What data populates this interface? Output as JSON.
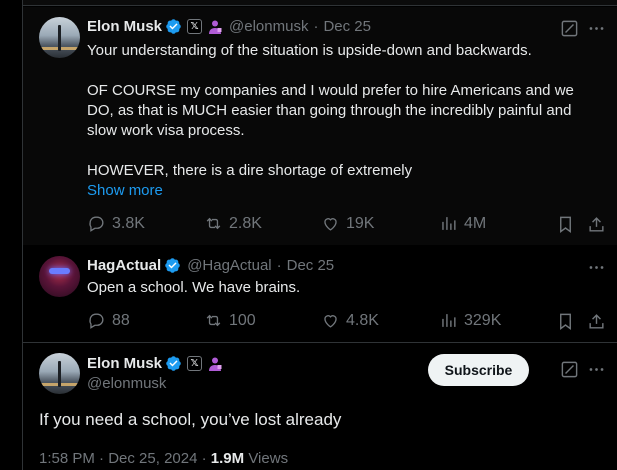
{
  "colors": {
    "background": "#000000",
    "text": "#e7e9ea",
    "muted": "#71767b",
    "link": "#1d9bf0",
    "verified": "#1d9bf0",
    "affiliate_badge": "#b05cd6"
  },
  "post1": {
    "name": "Elon Musk",
    "handle": "@elonmusk",
    "separator": "·",
    "date": "Dec 25",
    "paragraphs": [
      "Your understanding of the situation is upside-down and backwards.",
      "OF COURSE my companies and I would prefer to hire Americans and we DO, as that is MUCH easier than going through the incredibly painful and slow work visa process.",
      "HOWEVER, there is a dire shortage of extremely"
    ],
    "show_more": "Show more",
    "replies": "3.8K",
    "reposts": "2.8K",
    "likes": "19K",
    "views": "4M",
    "icons": [
      "verified-icon",
      "x-badge-icon",
      "affiliate-badge-icon",
      "grok-icon",
      "more-icon",
      "reply-icon",
      "repost-icon",
      "like-icon",
      "views-icon",
      "bookmark-icon",
      "share-icon"
    ]
  },
  "post2": {
    "name": "HagActual",
    "handle": "@HagActual",
    "separator": "·",
    "date": "Dec 25",
    "text": "Open a school. We have brains.",
    "replies": "88",
    "reposts": "100",
    "likes": "4.8K",
    "views": "329K"
  },
  "main_post": {
    "name": "Elon Musk",
    "handle": "@elonmusk",
    "subscribe_label": "Subscribe",
    "text": "If you need a school, you’ve lost already",
    "time": "1:58 PM",
    "separator": "·",
    "date": "Dec 25, 2024",
    "views_count": "1.9M",
    "views_label": "Views"
  }
}
